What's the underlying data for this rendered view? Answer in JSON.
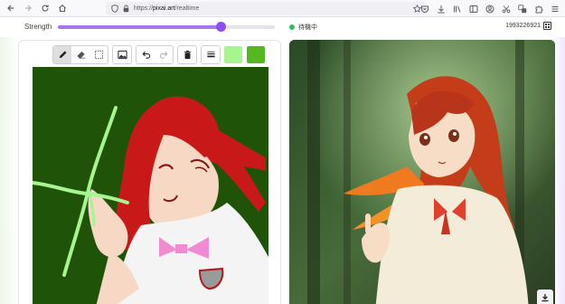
{
  "browser": {
    "url_scheme": "https://",
    "url_host": "pixai.art",
    "url_path": "/realtime"
  },
  "appbar": {
    "strength_label": "Strength",
    "strength_value": 0.75,
    "status_text": "待機中",
    "seed": "1993226921"
  },
  "toolbar": {
    "tools": [
      {
        "icon": "pencil-icon",
        "active": true
      },
      {
        "icon": "eraser-icon",
        "active": false
      },
      {
        "icon": "selection-icon",
        "active": false
      },
      {
        "icon": "image-icon",
        "active": false
      },
      {
        "icon": "undo-icon",
        "active": false
      },
      {
        "icon": "redo-icon",
        "active": false
      },
      {
        "icon": "trash-icon",
        "active": false
      },
      {
        "icon": "line-width-icon",
        "active": false
      }
    ],
    "colors": {
      "primary": "#a6f58e",
      "secondary": "#56b820"
    }
  },
  "colors": {
    "accent": "#8d4ff5",
    "status": "#2fbf5f"
  }
}
